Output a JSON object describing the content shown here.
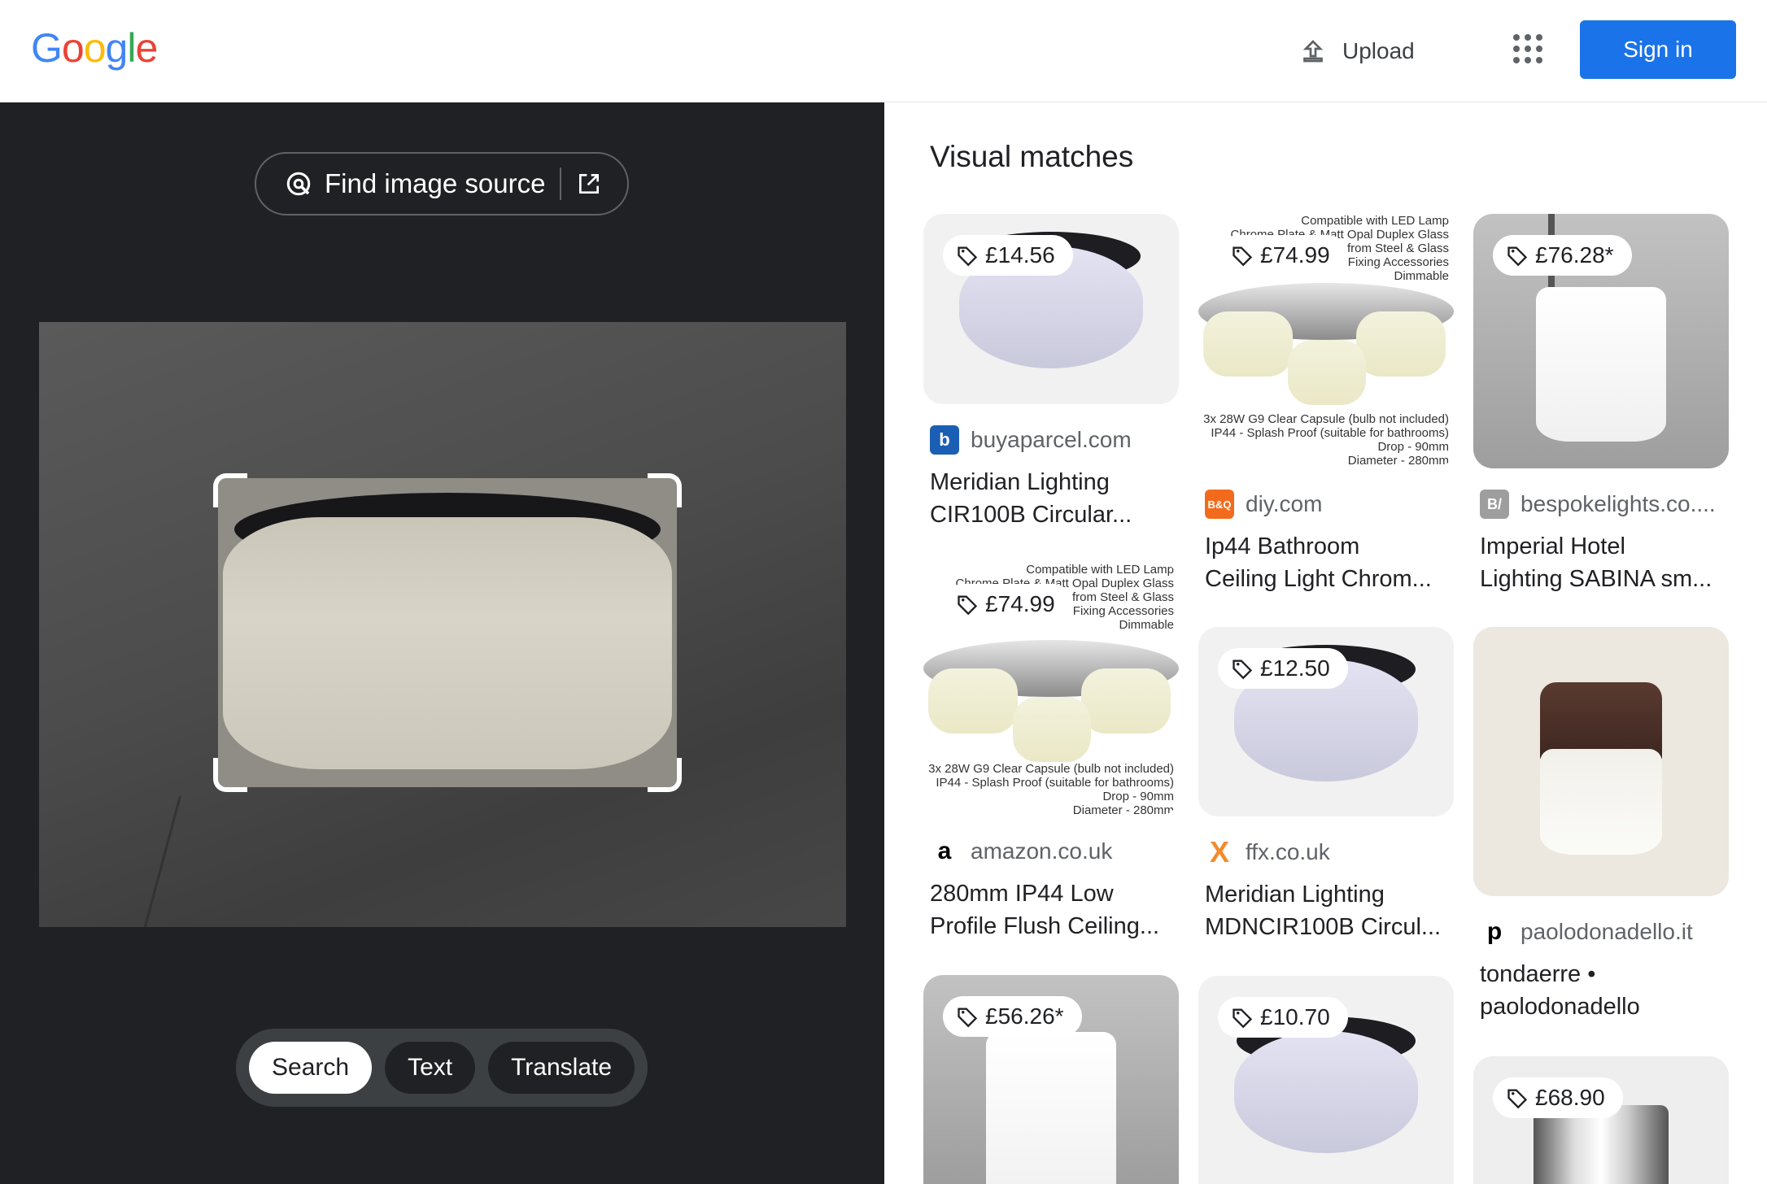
{
  "header": {
    "logo_letters": [
      {
        "ch": "G",
        "color": "#4285F4"
      },
      {
        "ch": "o",
        "color": "#EA4335"
      },
      {
        "ch": "o",
        "color": "#FBBC05"
      },
      {
        "ch": "g",
        "color": "#4285F4"
      },
      {
        "ch": "l",
        "color": "#34A853"
      },
      {
        "ch": "e",
        "color": "#EA4335"
      }
    ],
    "upload_label": "Upload",
    "sign_in_label": "Sign in"
  },
  "left": {
    "find_source_label": "Find image source",
    "modes": [
      "Search",
      "Text",
      "Translate"
    ],
    "active_mode": "Search"
  },
  "results": {
    "title": "Visual matches",
    "items": [
      {
        "price": "£14.56",
        "source": "buyaparcel.com",
        "title_line1": "Meridian Lighting",
        "title_line2": "CIR100B Circular...",
        "favicon": "b"
      },
      {
        "price": "£74.99",
        "source": "diy.com",
        "title_line1": "Ip44 Bathroom",
        "title_line2": "Ceiling Light Chrom...",
        "favicon": "B&Q",
        "img_text": [
          "Compatible with LED Lamp",
          "Chrome Plate & Matt Opal Duplex Glass",
          "Made from Steel & Glass",
          "Fixing Accessories",
          "Dimmable",
          "3x 28W G9 Clear Capsule (bulb not included)",
          "IP44 - Splash Proof (suitable for bathrooms)",
          "Drop - 90mm",
          "Diameter - 280mm"
        ]
      },
      {
        "price": "£76.28*",
        "source": "bespokelights.co....",
        "title_line1": "Imperial Hotel",
        "title_line2": "Lighting SABINA sm...",
        "favicon": "B/"
      },
      {
        "price": "£74.99",
        "source": "amazon.co.uk",
        "title_line1": "280mm IP44 Low",
        "title_line2": "Profile Flush Ceiling...",
        "favicon": "a",
        "img_text": [
          "Compatible with LED Lamp",
          "Chrome Plate & Matt Opal Duplex Glass",
          "Made from Steel & Glass",
          "Fixing Accessories",
          "Dimmable",
          "3x 28W G9 Clear Capsule (bulb not included)",
          "IP44 - Splash Proof (suitable for bathrooms)",
          "Drop - 90mm",
          "Diameter - 280mm"
        ]
      },
      {
        "price": "£12.50",
        "source": "ffx.co.uk",
        "title_line1": "Meridian Lighting",
        "title_line2": "MDNCIR100B Circul...",
        "favicon": "X"
      },
      {
        "price": "",
        "source": "paolodonadello.it",
        "title_line1": "tondaerre •",
        "title_line2": "paolodonadello",
        "favicon": "p"
      },
      {
        "price": "£56.26*",
        "source": "",
        "title_line1": "",
        "title_line2": "",
        "favicon": ""
      },
      {
        "price": "£10.70",
        "source": "",
        "title_line1": "",
        "title_line2": "",
        "favicon": ""
      },
      {
        "price": "£68.90",
        "source": "",
        "title_line1": "",
        "title_line2": "",
        "favicon": ""
      }
    ]
  },
  "colors": {
    "accent": "#1a73e8",
    "dark_panel": "#202124"
  },
  "icons": [
    "upload-icon",
    "apps-grid-icon",
    "lens-search-icon",
    "external-link-icon",
    "price-tag-icon"
  ]
}
